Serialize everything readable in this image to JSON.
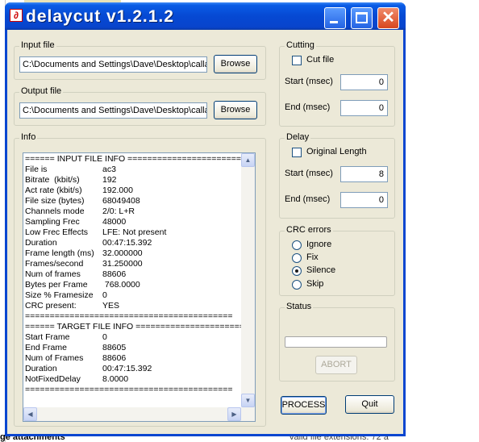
{
  "background": {
    "bottom_left_text": "ge attachments",
    "bottom_right_text": "Valid file extensions: 72 a"
  },
  "window": {
    "title": "delaycut v1.2.1.2",
    "icon": "app-icon"
  },
  "input_file": {
    "label": "Input file",
    "value": "C:\\Documents and Settings\\Dave\\Desktop\\calla",
    "browse_label": "Browse"
  },
  "output_file": {
    "label": "Output file",
    "value": "C:\\Documents and Settings\\Dave\\Desktop\\calla",
    "browse_label": "Browse"
  },
  "info": {
    "label": "Info",
    "rows": [
      {
        "key": "====== INPUT FILE INFO =========================",
        "val": ""
      },
      {
        "key": "File is",
        "val": "ac3"
      },
      {
        "key": "Bitrate  (kbit/s)",
        "val": "192"
      },
      {
        "key": "Act rate (kbit/s)",
        "val": "192.000"
      },
      {
        "key": "File size (bytes)",
        "val": "68049408"
      },
      {
        "key": "Channels mode",
        "val": "2/0: L+R"
      },
      {
        "key": "Sampling Frec",
        "val": "48000"
      },
      {
        "key": "Low Frec Effects",
        "val": "LFE: Not present"
      },
      {
        "key": "Duration",
        "val": "00:47:15.392"
      },
      {
        "key": "Frame length (ms)",
        "val": "32.000000"
      },
      {
        "key": "Frames/second",
        "val": "31.250000"
      },
      {
        "key": "Num of frames",
        "val": "88606"
      },
      {
        "key": "Bytes per Frame",
        "val": " 768.0000"
      },
      {
        "key": "Size % Framesize",
        "val": "0"
      },
      {
        "key": "CRC present:",
        "val": "YES"
      },
      {
        "key": "==========================================",
        "val": ""
      },
      {
        "key": "====== TARGET FILE INFO ========================",
        "val": ""
      },
      {
        "key": "Start Frame",
        "val": "0"
      },
      {
        "key": "End Frame",
        "val": "88605"
      },
      {
        "key": "Num of Frames",
        "val": "88606"
      },
      {
        "key": "Duration",
        "val": "00:47:15.392"
      },
      {
        "key": "NotFixedDelay",
        "val": "8.0000"
      },
      {
        "key": "==========================================",
        "val": ""
      }
    ]
  },
  "cutting": {
    "label": "Cutting",
    "cut_file_label": "Cut file",
    "cut_file_checked": false,
    "start_label": "Start (msec)",
    "start_value": "0",
    "end_label": "End (msec)",
    "end_value": "0"
  },
  "delay": {
    "label": "Delay",
    "original_length_label": "Original Length",
    "original_length_checked": false,
    "start_label": "Start (msec)",
    "start_value": "8",
    "end_label": "End (msec)",
    "end_value": "0"
  },
  "crc": {
    "label": "CRC errors",
    "options": [
      "Ignore",
      "Fix",
      "Silence",
      "Skip"
    ],
    "selected": "Silence"
  },
  "status": {
    "label": "Status",
    "progress": 0,
    "abort_label": "ABORT"
  },
  "actions": {
    "process_label": "PROCESS",
    "quit_label": "Quit"
  }
}
